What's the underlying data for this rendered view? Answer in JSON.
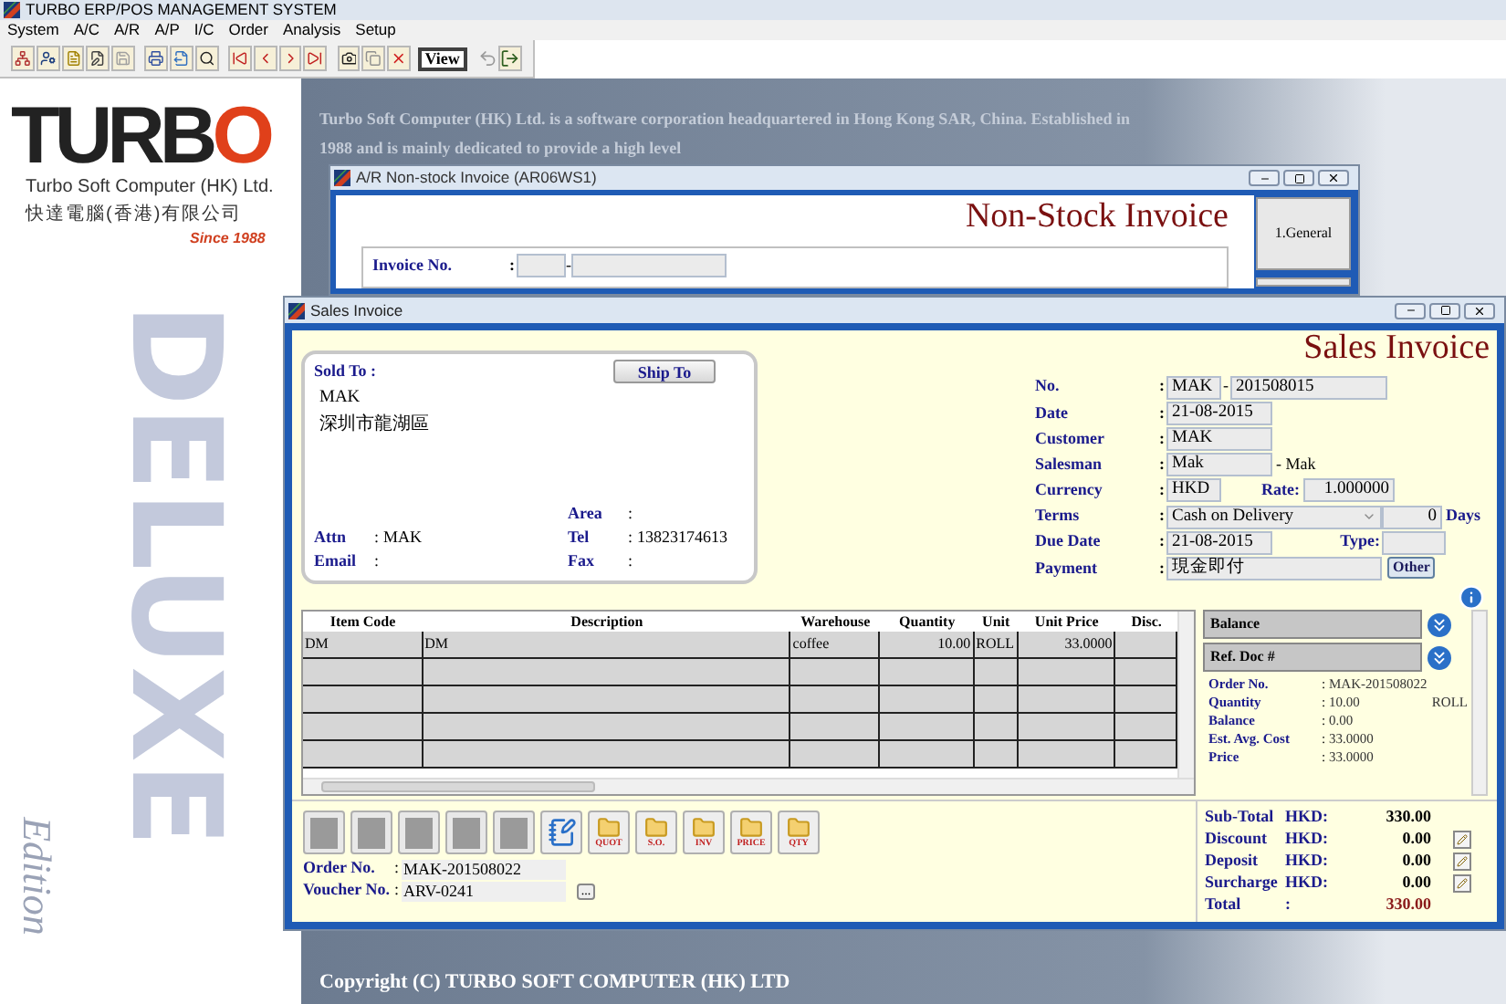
{
  "app_title": "TURBO ERP/POS MANAGEMENT SYSTEM",
  "menu": [
    "System",
    "A/C",
    "A/R",
    "A/P",
    "I/C",
    "Order",
    "Analysis",
    "Setup"
  ],
  "toolbar": {
    "view_label": "View"
  },
  "brand": {
    "logo_dark": "TURB",
    "logo_accent": "O",
    "company": "Turbo Soft Computer (HK) Ltd.",
    "company_zh": "快達電腦(香港)有限公司",
    "since": "Since 1988",
    "edition_big": "DELUXE",
    "edition": "Edition"
  },
  "background_text": [
    "Turbo Soft Computer (HK) Ltd. is a software corporation headquartered in Hong Kong SAR, China. Established in",
    "1988 and is mainly dedicated to provide a high level"
  ],
  "copyright": "Copyright (C) TURBO SOFT COMPUTER (HK) LTD",
  "back_window": {
    "title": "A/R Non-stock Invoice (AR06WS1)",
    "heading": "Non-Stock Invoice",
    "invoice_label": "Invoice No.",
    "colon": ":",
    "dash": "-",
    "side_button": "1.General"
  },
  "window": {
    "title": "Sales Invoice",
    "heading": "Sales Invoice",
    "sold_to": {
      "label": "Sold To :",
      "ship_to": "Ship To",
      "name": "MAK",
      "address": "深圳市龍湖區",
      "left_fields": [
        {
          "label": "Attn",
          "colon": ":",
          "value": "MAK"
        },
        {
          "label": "Email",
          "colon": ":"
        }
      ],
      "right_fields": [
        {
          "label": "Area",
          "colon": ":"
        },
        {
          "label": "Tel",
          "colon": ":",
          "value": "13823174613"
        },
        {
          "label": "Fax",
          "colon": ":"
        }
      ]
    },
    "form": [
      {
        "kind": "split",
        "label": "No.",
        "colon": ":",
        "prefix": "MAK",
        "dash": "-",
        "value": "201508015"
      },
      {
        "kind": "text",
        "label": "Date",
        "colon": ":",
        "value": "21-08-2015"
      },
      {
        "kind": "text",
        "label": "Customer",
        "colon": ":",
        "value": "MAK"
      },
      {
        "kind": "suffix",
        "label": "Salesman",
        "colon": ":",
        "value": "Mak",
        "suffix": "- Mak"
      },
      {
        "kind": "rate",
        "label": "Currency",
        "colon": ":",
        "value": "HKD",
        "extra_label": "Rate:",
        "extra_value": "1.000000"
      },
      {
        "kind": "terms",
        "label": "Terms",
        "colon": ":",
        "value": "Cash on Delivery",
        "days": "0",
        "days_label": "Days"
      },
      {
        "kind": "type",
        "label": "Due Date",
        "colon": ":",
        "value": "21-08-2015",
        "extra_label": "Type:"
      },
      {
        "kind": "payment",
        "label": "Payment",
        "colon": ":",
        "value": "現金即付",
        "button": "Other"
      }
    ],
    "table": {
      "columns": [
        "Item Code",
        "Description",
        "Warehouse",
        "Quantity",
        "Unit",
        "Unit Price",
        "Disc."
      ],
      "rows": [
        [
          "DM",
          "DM",
          "coffee",
          "10.00",
          "ROLL",
          "33.0000",
          ""
        ]
      ]
    },
    "side_panel": {
      "sections": [
        "Balance",
        "Ref. Doc #"
      ],
      "details": [
        {
          "label": "Order No.",
          "colon": ":",
          "value": "MAK-201508022"
        },
        {
          "label": "Quantity",
          "colon": ":",
          "value": "10.00",
          "unit": "ROLL"
        },
        {
          "label": "Balance",
          "colon": ":",
          "value": "0.00"
        },
        {
          "label": "Est. Avg. Cost",
          "colon": ":",
          "value": "33.0000"
        },
        {
          "label": "Price",
          "colon": ":",
          "value": "33.0000"
        }
      ]
    },
    "doc_buttons": [
      {
        "kind": "blank"
      },
      {
        "kind": "blank"
      },
      {
        "kind": "blank"
      },
      {
        "kind": "blank"
      },
      {
        "kind": "blank"
      },
      {
        "kind": "notebook"
      },
      {
        "kind": "folder",
        "label": "QUOT"
      },
      {
        "kind": "folder",
        "label": "S.O."
      },
      {
        "kind": "folder",
        "label": "INV"
      },
      {
        "kind": "folder",
        "label": "PRICE"
      },
      {
        "kind": "folder",
        "label": "QTY"
      }
    ],
    "refs": [
      {
        "label": "Order No.",
        "colon": ":",
        "value": "MAK-201508022",
        "lookup": false
      },
      {
        "label": "Voucher No.",
        "colon": ":",
        "value": "ARV-0241",
        "lookup": true,
        "lookup_label": "..."
      }
    ],
    "totals": [
      {
        "kind": "amount",
        "label": "Sub-Total",
        "unit": "HKD:",
        "value": "330.00",
        "editable": false
      },
      {
        "kind": "amount",
        "label": "Discount",
        "unit": "HKD:",
        "value": "0.00",
        "editable": true
      },
      {
        "kind": "amount",
        "label": "Deposit",
        "unit": "HKD:",
        "value": "0.00",
        "editable": true
      },
      {
        "kind": "amount",
        "label": "Surcharge",
        "unit": "HKD:",
        "value": "0.00",
        "editable": true
      },
      {
        "kind": "total",
        "label": "Total",
        "unit": ":",
        "value": "330.00",
        "editable": false
      }
    ]
  }
}
